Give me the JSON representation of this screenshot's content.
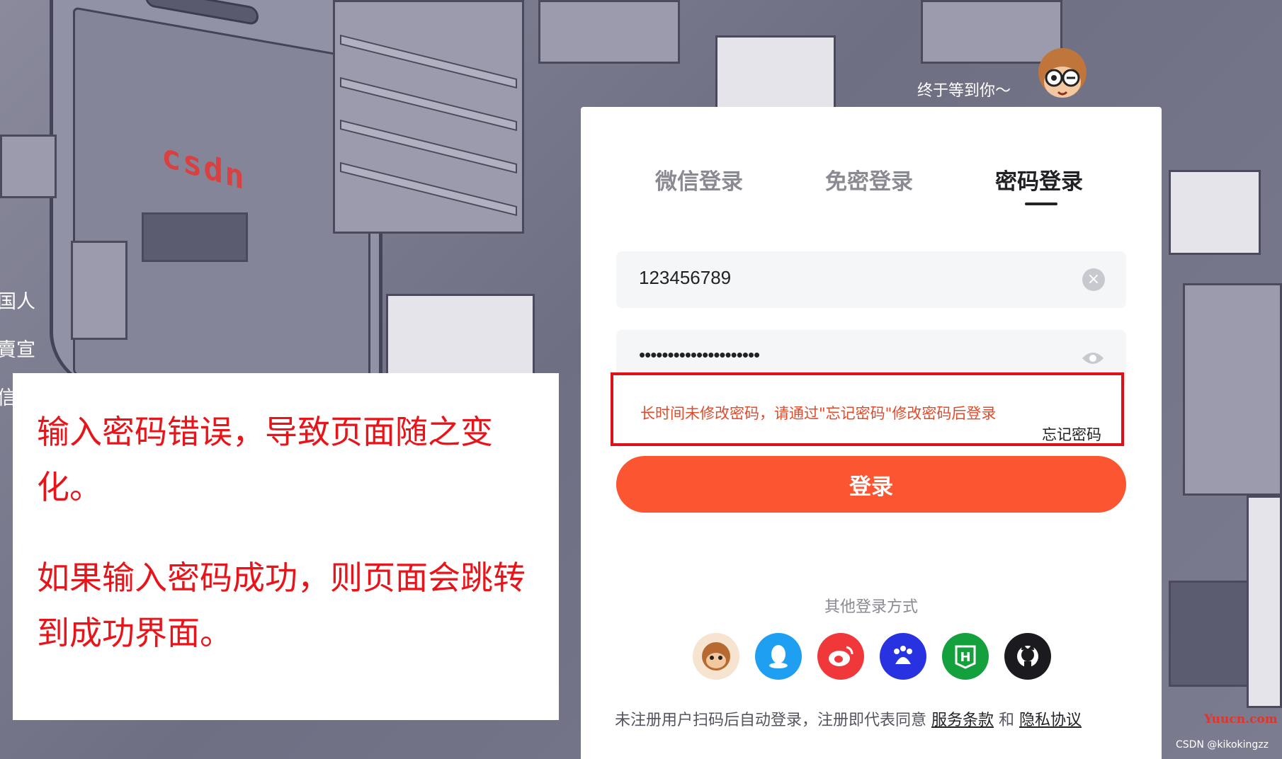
{
  "background": {
    "side_texts": [
      "国人",
      "賣宣",
      "信"
    ],
    "tagline": "终于等到你～",
    "logo_text": "csdn",
    "watermark_site": "Yuucn.com",
    "watermark_author": "CSDN @kikokingzz"
  },
  "login": {
    "tabs": [
      "微信登录",
      "免密登录",
      "密码登录"
    ],
    "active_tab": "密码登录",
    "account_value": "123456789",
    "password_value": "•••••••••••••••••••••",
    "error_message": "长时间未修改密码，请通过\"忘记密码\"修改密码后登录",
    "forgot_label": "忘记密码",
    "submit_label": "登录",
    "other_methods_title": "其他登录方式",
    "social_icons": [
      "csdn-mascot-icon",
      "qq-icon",
      "weibo-icon",
      "baidu-icon",
      "h-icon",
      "github-icon"
    ],
    "footer_prefix": "未注册用户扫码后自动登录，注册即代表同意",
    "terms_label": "服务条款",
    "and_label": "和",
    "privacy_label": "隐私协议"
  },
  "annotation": {
    "line1": "输入密码错误，导致页面随之变化。",
    "line2": "如果输入密码成功，则页面会跳转到成功界面。"
  },
  "colors": {
    "accent": "#fc5531",
    "error": "#e24a2a",
    "annotation": "#e8141a",
    "highlight_border": "#e01018"
  }
}
